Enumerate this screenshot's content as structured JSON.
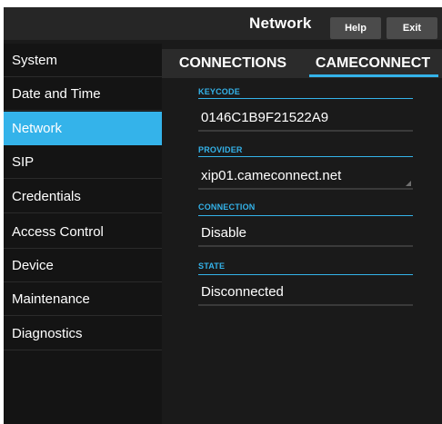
{
  "header": {
    "title": "Network",
    "help_label": "Help",
    "exit_label": "Exit"
  },
  "sidebar": {
    "items": [
      {
        "label": "System"
      },
      {
        "label": "Date and Time"
      },
      {
        "label": "Network"
      },
      {
        "label": "SIP"
      },
      {
        "label": "Credentials"
      },
      {
        "label": "Access Control"
      },
      {
        "label": "Device"
      },
      {
        "label": "Maintenance"
      },
      {
        "label": "Diagnostics"
      }
    ],
    "active_item": "Network"
  },
  "tabs": [
    {
      "label": "CONNECTIONS"
    },
    {
      "label": "CAMECONNECT"
    }
  ],
  "active_tab": "CAMECONNECT",
  "fields": {
    "keycode": {
      "label": "KEYCODE",
      "value": "0146C1B9F21522A9"
    },
    "provider": {
      "label": "PROVIDER",
      "value": "xip01.cameconnect.net"
    },
    "connection": {
      "label": "CONNECTION",
      "value": "Disable"
    },
    "state": {
      "label": "STATE",
      "value": "Disconnected"
    }
  },
  "colors": {
    "accent": "#34b3ea",
    "background": "#1a1a1a",
    "sidebar_background": "#141414",
    "button_background": "#4b4b4b"
  }
}
